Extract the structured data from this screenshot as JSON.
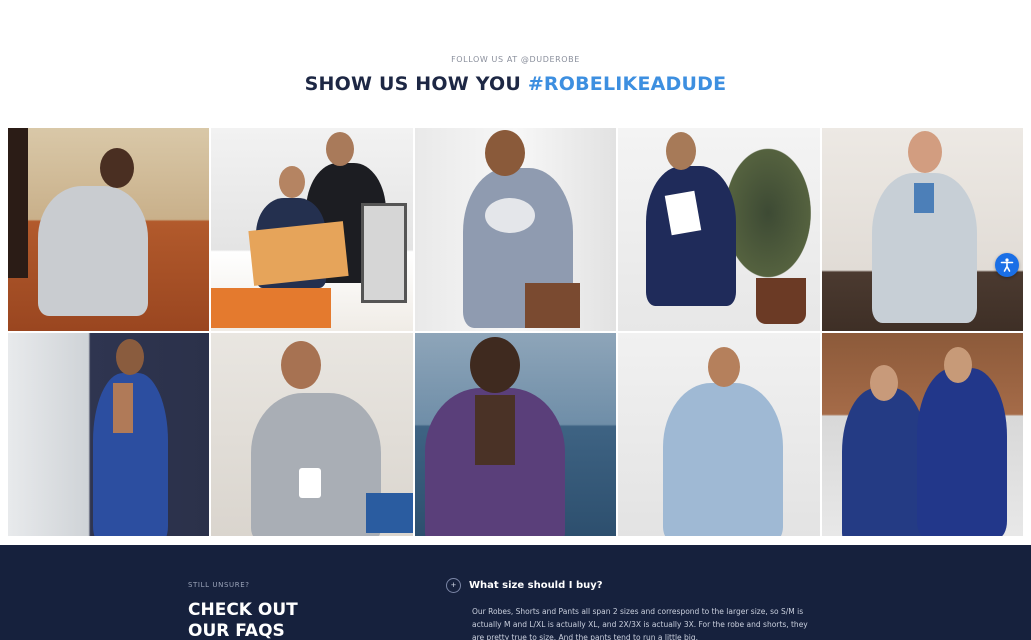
{
  "instagram": {
    "eyebrow": "FOLLOW US AT @DUDEROBE",
    "heading_main": "SHOW US HOW YOU ",
    "heading_tag": "#ROBELIKEADUDE",
    "accent_color": "#3d8fe0"
  },
  "gallery": {
    "photos": [
      {
        "label": "Man in gray robe on orange armchair"
      },
      {
        "label": "Two men reading a book at table"
      },
      {
        "label": "Man holding baby in gray robe"
      },
      {
        "label": "Man in navy robe reading on stool"
      },
      {
        "label": "Man in light gray robe indoors"
      },
      {
        "label": "Man in navy robe by window"
      },
      {
        "label": "Man in gray hooded robe with mug"
      },
      {
        "label": "Man in purple hooded robe by sea"
      },
      {
        "label": "Man in light blue hooded robe"
      },
      {
        "label": "Two men in navy hooded robes"
      }
    ]
  },
  "accessibility": {
    "icon": "accessibility-icon",
    "color": "#1a6fe6"
  },
  "faq": {
    "eyebrow": "STILL UNSURE?",
    "title": "CHECK OUT OUR FAQS",
    "question": "What size should I buy?",
    "toggle": "+",
    "answer": "Our Robes, Shorts and Pants all span 2 sizes and correspond to the larger size, so S/M is actually M and L/XL is actually XL, and 2X/3X is actually 3X. For the robe and shorts, they are pretty true to size. And the pants tend to run a little big.",
    "background": "#16213d"
  }
}
